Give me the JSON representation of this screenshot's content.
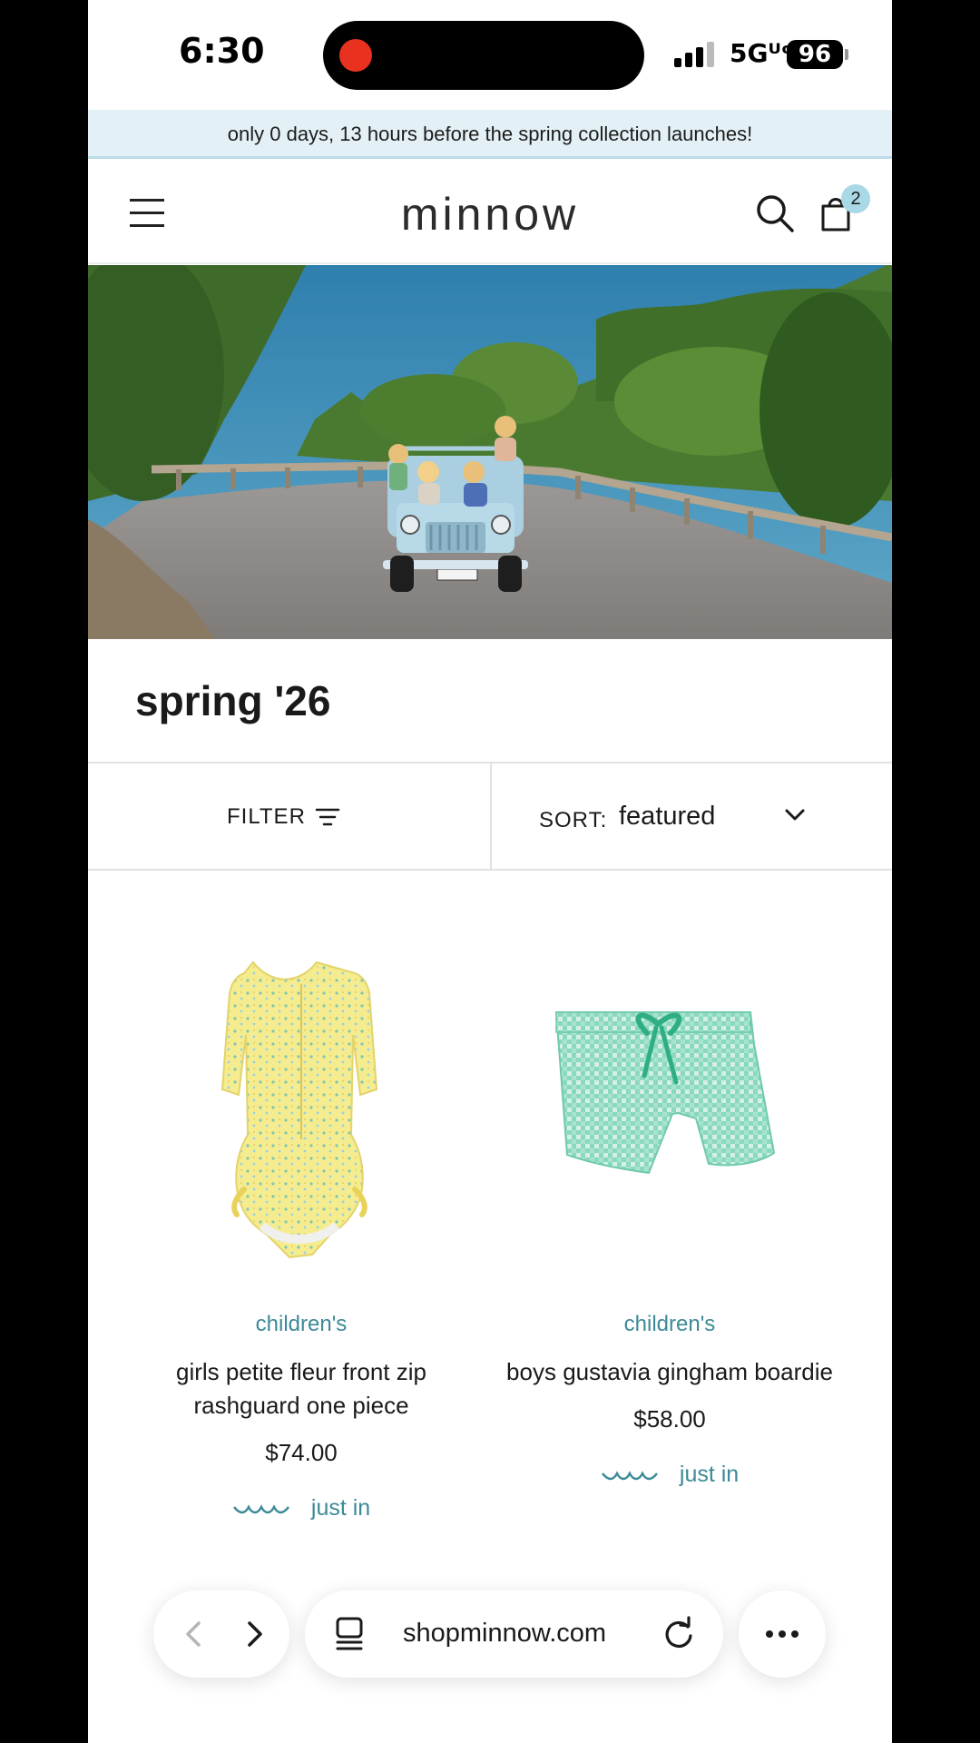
{
  "status_bar": {
    "time": "6:30",
    "network": "5Gᵁᶜ",
    "battery": "96"
  },
  "announcement": {
    "text": "only 0 days, 13 hours before the spring collection launches!"
  },
  "header": {
    "logo": "minnow",
    "cart_count": "2"
  },
  "hero": {
    "alt": "children driving a light blue jeep on a coastal road"
  },
  "collection": {
    "title": "spring '26"
  },
  "filter_bar": {
    "filter_label": "FILTER",
    "sort_label": "SORT:",
    "sort_value": "featured"
  },
  "products": [
    {
      "category": "children's",
      "name": "girls petite fleur front zip rashguard one piece",
      "price": "$74.00",
      "badge": "just in",
      "colors": {
        "main": "#f4eb8c",
        "accent": "#e9d25a"
      }
    },
    {
      "category": "children's",
      "name": "boys gustavia gingham boardie",
      "price": "$58.00",
      "badge": "just in",
      "colors": {
        "main": "#8fdcc0",
        "accent": "#2fae86"
      }
    }
  ],
  "browser": {
    "url": "shopminnow.com"
  },
  "colors": {
    "accent": "#3c8a97",
    "announce_bg": "#e3f1f6",
    "cart_badge": "#a9d8e6"
  },
  "icons": [
    "hamburger-icon",
    "search-icon",
    "cart-icon",
    "filter-icon",
    "chevron-down-icon",
    "wave-icon",
    "back-icon",
    "forward-icon",
    "tabs-icon",
    "reload-icon",
    "more-icon"
  ]
}
